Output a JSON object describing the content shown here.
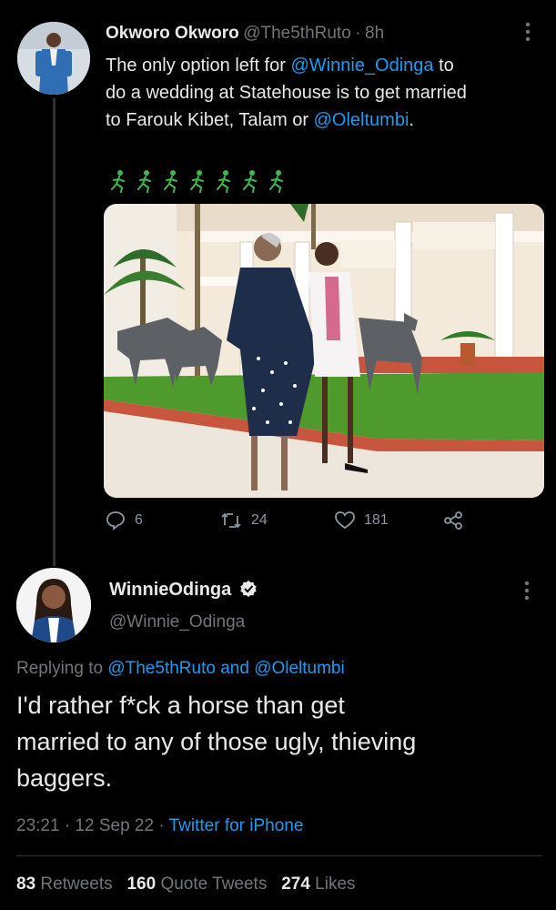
{
  "tweet1": {
    "display_name": "Okworo Okworo",
    "handle": "@The5thRuto",
    "separator": "·",
    "time": "8h",
    "text_line1_a": "The only option left for ",
    "mention_winnie": "@Winnie_Odinga",
    "text_line1_b": " to",
    "text_line2": "do a wedding at Statehouse is to get married",
    "text_line3_a": "to Farouk Kibet, Talam or ",
    "mention_oleltumbi": "@Oleltumbi",
    "text_line3_b": ".",
    "emoji_row": "🏃🏃🏃🏃🏃🏃🏃",
    "replies": "6",
    "retweets": "24",
    "likes": "181"
  },
  "tweet2": {
    "display_name": "WinnieOdinga",
    "handle": "@Winnie_Odinga",
    "replying_prefix": "Replying to ",
    "reply_mention1": "@The5thRuto",
    "reply_and": " and ",
    "reply_mention2": "@Oleltumbi",
    "text_line1": "I'd rather f*ck a horse than get",
    "text_line2": "married to any of those ugly, thieving",
    "text_line3": "baggers.",
    "timestamp": "23:21 · 12 Sep 22 · ",
    "source": "Twitter for iPhone",
    "retweets_count": "83",
    "retweets_label": "Retweets",
    "quote_count": "160",
    "quote_label": "Quote Tweets",
    "likes_count": "274",
    "likes_label": "Likes"
  },
  "colors": {
    "background": "#000000",
    "text": "#e7e9ea",
    "muted": "#71767b",
    "link": "#1d9bf0",
    "verified": "#e7e9ea"
  }
}
